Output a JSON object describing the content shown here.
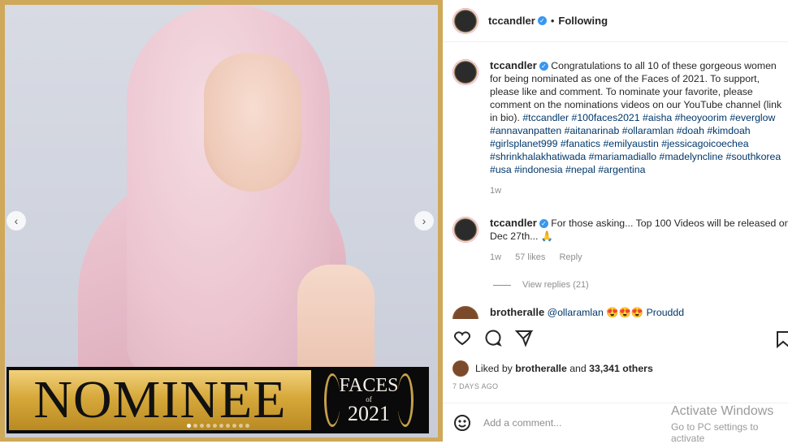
{
  "post_image": {
    "banner_word": "NOMINEE",
    "badge_title": "FACES",
    "badge_of": "of",
    "badge_year": "2021",
    "carousel_icons": {
      "prev": "chevron-left-icon",
      "next": "chevron-right-icon"
    }
  },
  "header": {
    "username": "tccandler",
    "separator": "•",
    "follow_status": "Following"
  },
  "comments": [
    {
      "username": "tccandler",
      "text": "Congratulations to all 10 of these gorgeous women for being nominated as one of the Faces of 2021.  To support, please like and comment.  To nominate your favorite,  please comment on the nominations videos on our YouTube channel (link in bio).",
      "hashtags": "#tccandler #100faces2021 #aisha #heoyoorim #everglow #annavanpatten #aitanarinab #ollaramlan #doah #kimdoah #girlsplanet999 #fanatics #emilyaustin #jessicagoicoechea #shrinkhalakhatiwada #mariamadiallo #madelyncline #southkorea #usa #indonesia #nepal #argentina",
      "time": "1w"
    },
    {
      "username": "tccandler",
      "text": "For those asking... Top 100 Videos will be released on Dec 27th... 🙏",
      "time": "1w",
      "likes": "57 likes",
      "reply": "Reply",
      "view_replies": "View replies (21)"
    },
    {
      "username": "brotheralle",
      "text": "@ollaramlan 😍😍😍 Prouddd"
    }
  ],
  "actions": {
    "like_icon": "heart-icon",
    "comment_icon": "comment-icon",
    "share_icon": "paper-plane-icon",
    "save_icon": "bookmark-icon"
  },
  "likes": {
    "prefix": "Liked by",
    "user": "brotheralle",
    "middle": "and",
    "others": "33,341 others"
  },
  "post_date": "7 DAYS AGO",
  "add_comment": {
    "placeholder": "Add a comment...",
    "emoji_icon": "smiley-icon"
  },
  "watermark": {
    "line1": "Activate Windows",
    "line2": "Go to PC settings to activate"
  }
}
